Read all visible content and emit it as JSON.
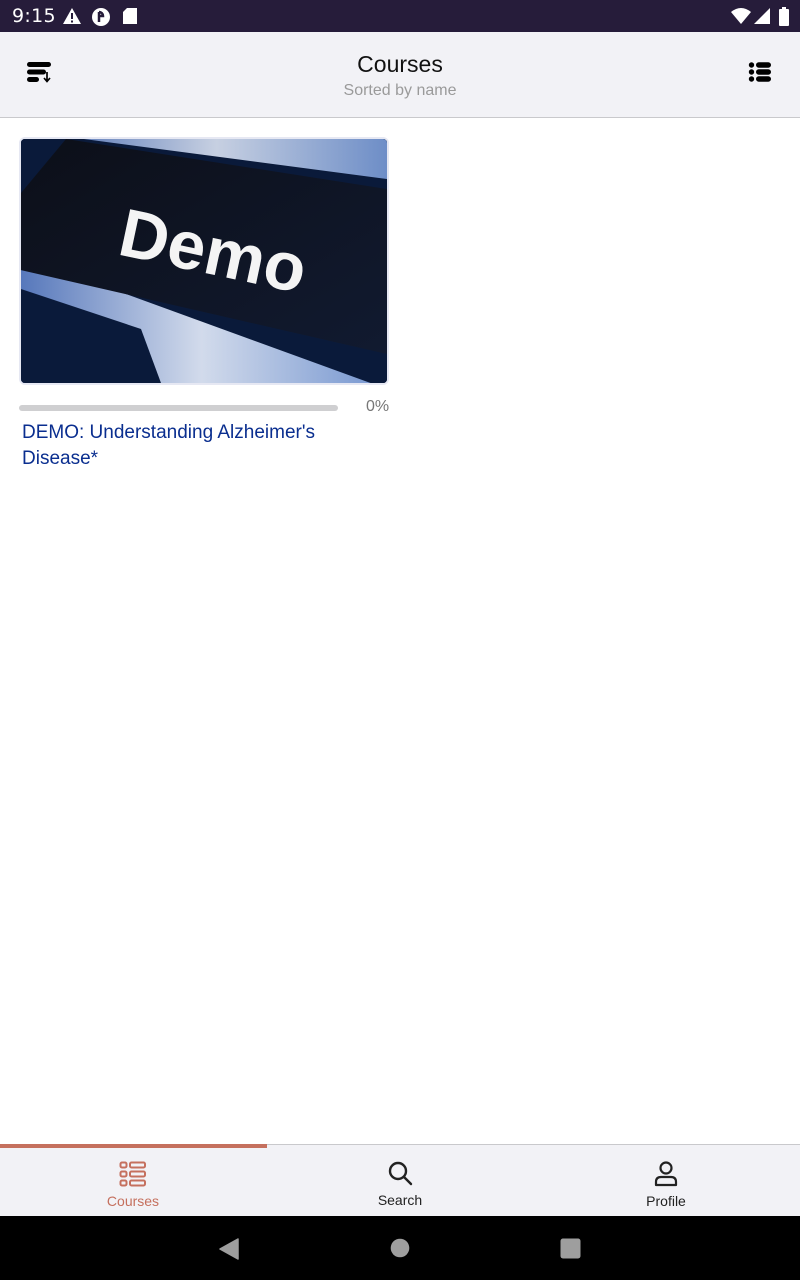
{
  "status_bar": {
    "time": "9:15",
    "left_icons": [
      "warning-icon",
      "data-saver-icon",
      "sd-card-icon"
    ],
    "right_icons": [
      "wifi-icon",
      "cell-signal-icon",
      "battery-icon"
    ]
  },
  "app_bar": {
    "title": "Courses",
    "subtitle": "Sorted by name",
    "left_button_icon": "sort-icon",
    "right_button_icon": "list-view-icon"
  },
  "courses": [
    {
      "thumbnail_text": "Demo",
      "progress_percent": 0,
      "progress_label": "0%",
      "title": "DEMO: Understanding Alzheimer's Disease*"
    }
  ],
  "bottom_nav": {
    "active_index": 0,
    "tabs": [
      {
        "label": "Courses",
        "icon": "courses-grid-icon"
      },
      {
        "label": "Search",
        "icon": "search-icon"
      },
      {
        "label": "Profile",
        "icon": "profile-icon"
      }
    ]
  },
  "colors": {
    "accent": "#c5705e",
    "link": "#0a2e8f",
    "status_bar": "#261c3a"
  }
}
